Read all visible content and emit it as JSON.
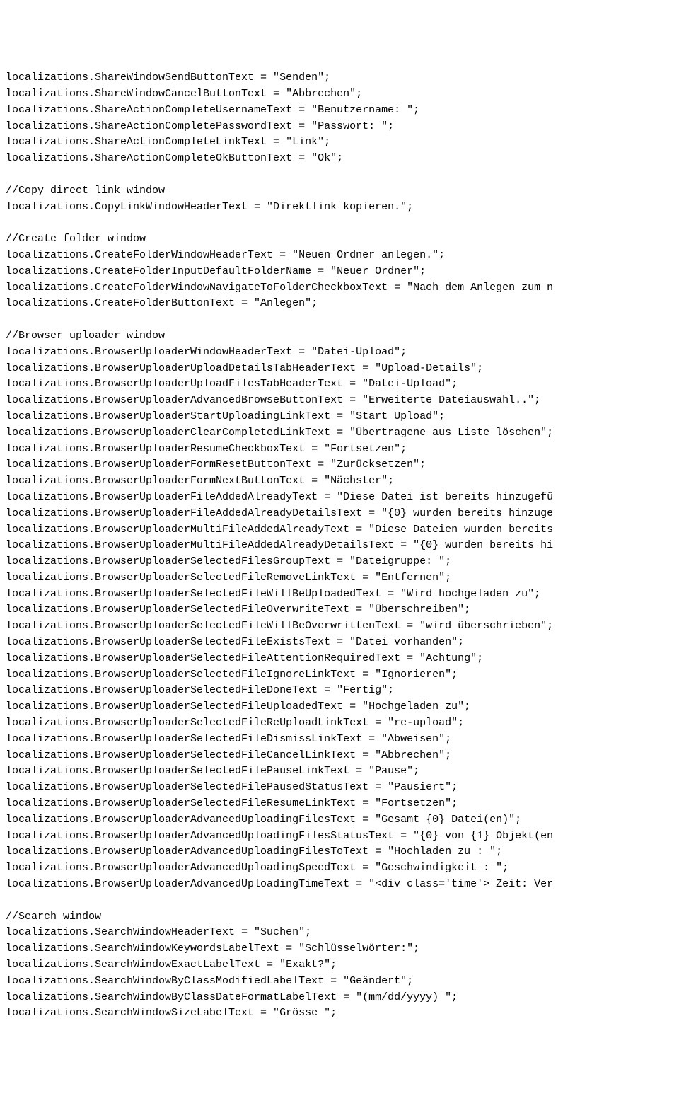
{
  "lines": [
    "localizations.ShareWindowSendButtonText = \"Senden\";",
    "localizations.ShareWindowCancelButtonText = \"Abbrechen\";",
    "localizations.ShareActionCompleteUsernameText = \"Benutzername: \";",
    "localizations.ShareActionCompletePasswordText = \"Passwort: \";",
    "localizations.ShareActionCompleteLinkText = \"Link\";",
    "localizations.ShareActionCompleteOkButtonText = \"Ok\";",
    "",
    "//Copy direct link window",
    "localizations.CopyLinkWindowHeaderText = \"Direktlink kopieren.\";",
    "",
    "//Create folder window",
    "localizations.CreateFolderWindowHeaderText = \"Neuen Ordner anlegen.\";",
    "localizations.CreateFolderInputDefaultFolderName = \"Neuer Ordner\";",
    "localizations.CreateFolderWindowNavigateToFolderCheckboxText = \"Nach dem Anlegen zum n",
    "localizations.CreateFolderButtonText = \"Anlegen\";",
    "",
    "//Browser uploader window",
    "localizations.BrowserUploaderWindowHeaderText = \"Datei-Upload\";",
    "localizations.BrowserUploaderUploadDetailsTabHeaderText = \"Upload-Details\";",
    "localizations.BrowserUploaderUploadFilesTabHeaderText = \"Datei-Upload\";",
    "localizations.BrowserUploaderAdvancedBrowseButtonText = \"Erweiterte Dateiauswahl..\";",
    "localizations.BrowserUploaderStartUploadingLinkText = \"Start Upload\";",
    "localizations.BrowserUploaderClearCompletedLinkText = \"Übertragene aus Liste löschen\";",
    "localizations.BrowserUploaderResumeCheckboxText = \"Fortsetzen\";",
    "localizations.BrowserUploaderFormResetButtonText = \"Zurücksetzen\";",
    "localizations.BrowserUploaderFormNextButtonText = \"Nächster\";",
    "localizations.BrowserUploaderFileAddedAlreadyText = \"Diese Datei ist bereits hinzugefü",
    "localizations.BrowserUploaderFileAddedAlreadyDetailsText = \"{0} wurden bereits hinzuge",
    "localizations.BrowserUploaderMultiFileAddedAlreadyText = \"Diese Dateien wurden bereits",
    "localizations.BrowserUploaderMultiFileAddedAlreadyDetailsText = \"{0} wurden bereits hi",
    "localizations.BrowserUploaderSelectedFilesGroupText = \"Dateigruppe: \";",
    "localizations.BrowserUploaderSelectedFileRemoveLinkText = \"Entfernen\";",
    "localizations.BrowserUploaderSelectedFileWillBeUploadedText = \"Wird hochgeladen zu\";",
    "localizations.BrowserUploaderSelectedFileOverwriteText = \"Überschreiben\";",
    "localizations.BrowserUploaderSelectedFileWillBeOverwrittenText = \"wird überschrieben\";",
    "localizations.BrowserUploaderSelectedFileExistsText = \"Datei vorhanden\";",
    "localizations.BrowserUploaderSelectedFileAttentionRequiredText = \"Achtung\";",
    "localizations.BrowserUploaderSelectedFileIgnoreLinkText = \"Ignorieren\";",
    "localizations.BrowserUploaderSelectedFileDoneText = \"Fertig\";",
    "localizations.BrowserUploaderSelectedFileUploadedText = \"Hochgeladen zu\";",
    "localizations.BrowserUploaderSelectedFileReUploadLinkText = \"re-upload\";",
    "localizations.BrowserUploaderSelectedFileDismissLinkText = \"Abweisen\";",
    "localizations.BrowserUploaderSelectedFileCancelLinkText = \"Abbrechen\";",
    "localizations.BrowserUploaderSelectedFilePauseLinkText = \"Pause\";",
    "localizations.BrowserUploaderSelectedFilePausedStatusText = \"Pausiert\";",
    "localizations.BrowserUploaderSelectedFileResumeLinkText = \"Fortsetzen\";",
    "localizations.BrowserUploaderAdvancedUploadingFilesText = \"Gesamt {0} Datei(en)\";",
    "localizations.BrowserUploaderAdvancedUploadingFilesStatusText = \"{0} von {1} Objekt(en",
    "localizations.BrowserUploaderAdvancedUploadingFilesToText = \"Hochladen zu : \";",
    "localizations.BrowserUploaderAdvancedUploadingSpeedText = \"Geschwindigkeit : \";",
    "localizations.BrowserUploaderAdvancedUploadingTimeText = \"<div class='time'> Zeit: Ver",
    "",
    "//Search window",
    "localizations.SearchWindowHeaderText = \"Suchen\";",
    "localizations.SearchWindowKeywordsLabelText = \"Schlüsselwörter:\";",
    "localizations.SearchWindowExactLabelText = \"Exakt?\";",
    "localizations.SearchWindowByClassModifiedLabelText = \"Geändert\";",
    "localizations.SearchWindowByClassDateFormatLabelText = \"(mm/dd/yyyy) \";",
    "localizations.SearchWindowSizeLabelText = \"Grösse \";"
  ]
}
